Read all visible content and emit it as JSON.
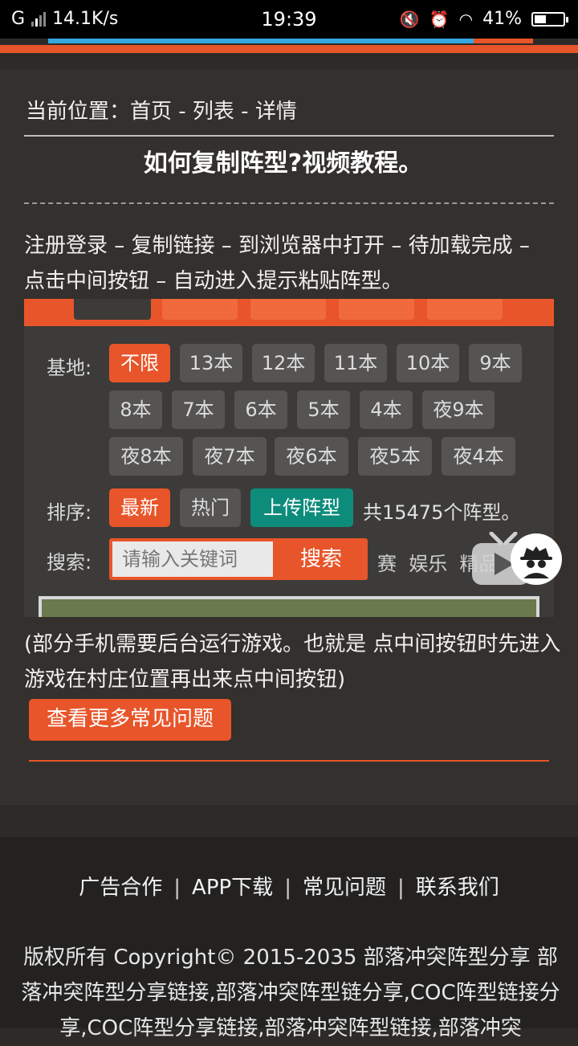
{
  "status_bar": {
    "network": "G",
    "speed": "14.1K/s",
    "time": "19:39",
    "battery": "41%"
  },
  "breadcrumb": "当前位置：首页 - 列表 - 详情",
  "title": "如何复制阵型?视频教程。",
  "steps_text": "注册登录 – 复制链接 – 到浏览器中打开 – 待加载完成 – 点击中间按钮 – 自动进入提示粘贴阵型。",
  "screenshot": {
    "base_label": "基地:",
    "base_options": [
      "不限",
      "13本",
      "12本",
      "11本",
      "10本",
      "9本",
      "8本",
      "7本",
      "6本",
      "5本",
      "4本",
      "夜9本",
      "夜8本",
      "夜7本",
      "夜6本",
      "夜5本",
      "夜4本"
    ],
    "sort_label": "排序:",
    "sort_options": [
      "最新",
      "热门",
      "上传阵型"
    ],
    "total_text": "共15475个阵型。",
    "search_label": "搜索:",
    "search_placeholder": "请输入关键词",
    "search_button": "搜索",
    "extra_tags": "赛  娱乐  精品"
  },
  "note_text": "(部分手机需要后台运行游戏。也就是 点中间按钮时先进入游戏在村庄位置再出来点中间按钮)",
  "more_button": "查看更多常见问题",
  "footer": {
    "links": [
      "广告合作",
      "APP下载",
      "常见问题",
      "联系我们"
    ],
    "separator": "|",
    "copyright": "版权所有 Copyright© 2015-2035 部落冲突阵型分享 部落冲突阵型分享链接,部落冲突阵型链分享,COC阵型链接分享,COC阵型分享链接,部落冲突阵型链接,部落冲突"
  },
  "colors": {
    "accent": "#e8552a",
    "green": "#0d8c7c",
    "background": "#33302d",
    "footer": "#232221"
  },
  "battery_level": 0.41
}
